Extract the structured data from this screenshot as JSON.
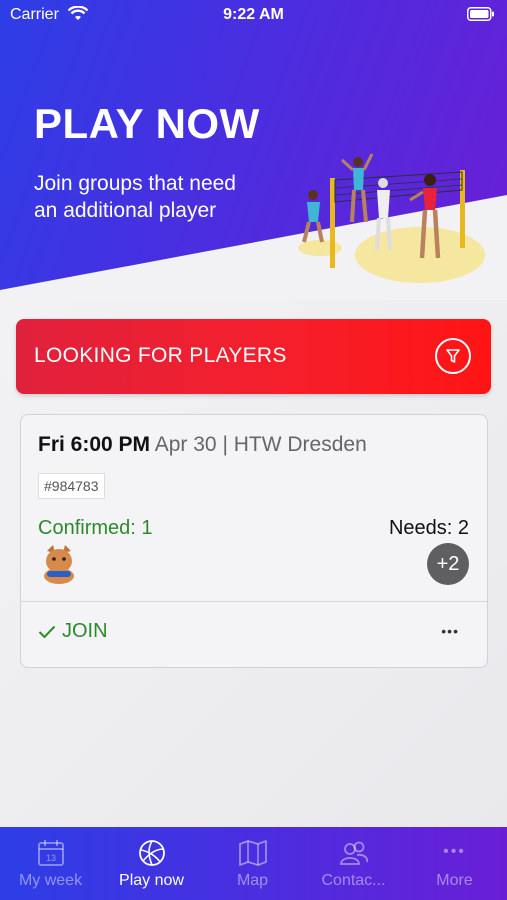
{
  "status_bar": {
    "carrier": "Carrier",
    "time": "9:22 AM"
  },
  "hero": {
    "title": "PLAY NOW",
    "subtitle": "Join groups that need an additional player"
  },
  "filter_bar": {
    "label": "LOOKING FOR PLAYERS",
    "icon": "filter-icon"
  },
  "game": {
    "time": "Fri 6:00 PM",
    "where": "Apr 30 | HTW Dresden",
    "id": "#984783",
    "confirmed": "Confirmed: 1",
    "needs": "Needs: 2",
    "extra": "+2",
    "join_label": "JOIN",
    "more": "•••"
  },
  "tabs": [
    {
      "label": "My week",
      "icon": "calendar-icon",
      "icon_text": "13"
    },
    {
      "label": "Play now",
      "icon": "volleyball-icon"
    },
    {
      "label": "Map",
      "icon": "map-icon"
    },
    {
      "label": "Contac...",
      "icon": "contacts-icon"
    },
    {
      "label": "More",
      "icon": "more-icon",
      "icon_text": "•••"
    }
  ],
  "colors": {
    "brand_blue": "#2d3ee6",
    "brand_purple": "#6a1fd6",
    "accent_red": "#f51f2c",
    "confirm_green": "#2c8a2c"
  }
}
